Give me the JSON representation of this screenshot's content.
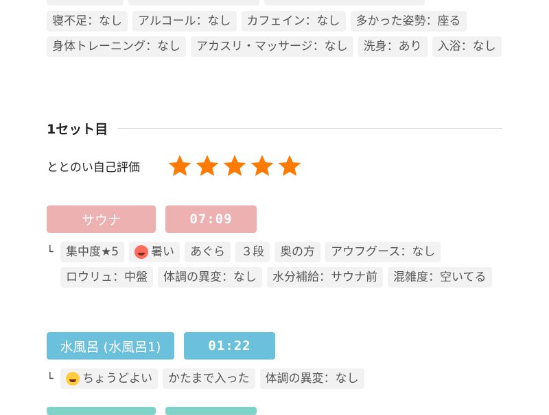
{
  "top_tags_row1": [
    "…",
    "…",
    "…"
  ],
  "condition_tags": [
    "寝不足：なし",
    "アルコール：なし",
    "カフェイン：なし",
    "多かった姿勢：座る",
    "身体トレーニング：なし",
    "アカスリ・マッサージ：なし",
    "洗身：あり",
    "入浴：なし"
  ],
  "set": {
    "title": "1セット目",
    "rating_label": "ととのい自己評価",
    "rating_stars": 5,
    "star_color": "#ff7a00",
    "sauna": {
      "label": "サウナ",
      "time": "07:09",
      "color": "#eeb1b2",
      "bullet": "└",
      "tags": [
        {
          "text": "集中度★5"
        },
        {
          "text": "暑い",
          "emoji": "hot-face-icon"
        },
        {
          "text": "あぐら"
        },
        {
          "text": "３段"
        },
        {
          "text": "奥の方"
        },
        {
          "text": "アウフグース：なし"
        },
        {
          "text": "ロウリュ：中盤"
        },
        {
          "text": "体調の異変：なし"
        },
        {
          "text": "水分補給：サウナ前"
        },
        {
          "text": "混雑度：空いてる"
        }
      ]
    },
    "water": {
      "label": "水風呂 (水風呂1)",
      "time": "01:22",
      "color": "#6bc0dc",
      "bullet": "└",
      "tags": [
        {
          "text": "ちょうどよい",
          "emoji": "grinning-face-icon"
        },
        {
          "text": "かたまで入った"
        },
        {
          "text": "体調の異変：なし"
        }
      ]
    }
  }
}
